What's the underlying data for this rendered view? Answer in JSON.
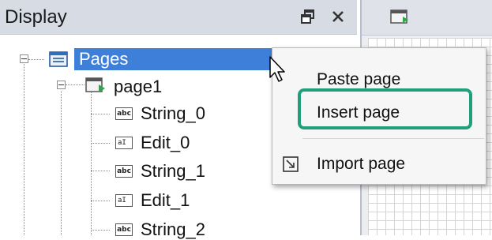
{
  "panel": {
    "title": "Display",
    "float_icon": "float-window-icon",
    "close_icon": "close-icon"
  },
  "tree": {
    "root": {
      "label": "Pages",
      "icon": "pages-icon"
    },
    "page": {
      "label": "page1",
      "icon": "page-icon"
    },
    "children": [
      {
        "label": "String_0",
        "icon": "string-widget-icon",
        "badge": "abc"
      },
      {
        "label": "Edit_0",
        "icon": "edit-widget-icon",
        "badge": "aI"
      },
      {
        "label": "String_1",
        "icon": "string-widget-icon",
        "badge": "abc"
      },
      {
        "label": "Edit_1",
        "icon": "edit-widget-icon",
        "badge": "aI"
      },
      {
        "label": "String_2",
        "icon": "string-widget-icon",
        "badge": "abc"
      }
    ]
  },
  "context_menu": {
    "items": [
      {
        "label": "Paste page"
      },
      {
        "label": "Insert page"
      },
      {
        "label": "Import page",
        "icon": "import-page-icon"
      }
    ]
  },
  "colors": {
    "selection": "#3e7fd9",
    "highlight_border": "#20a079",
    "panel_header": "#d7dce4"
  }
}
